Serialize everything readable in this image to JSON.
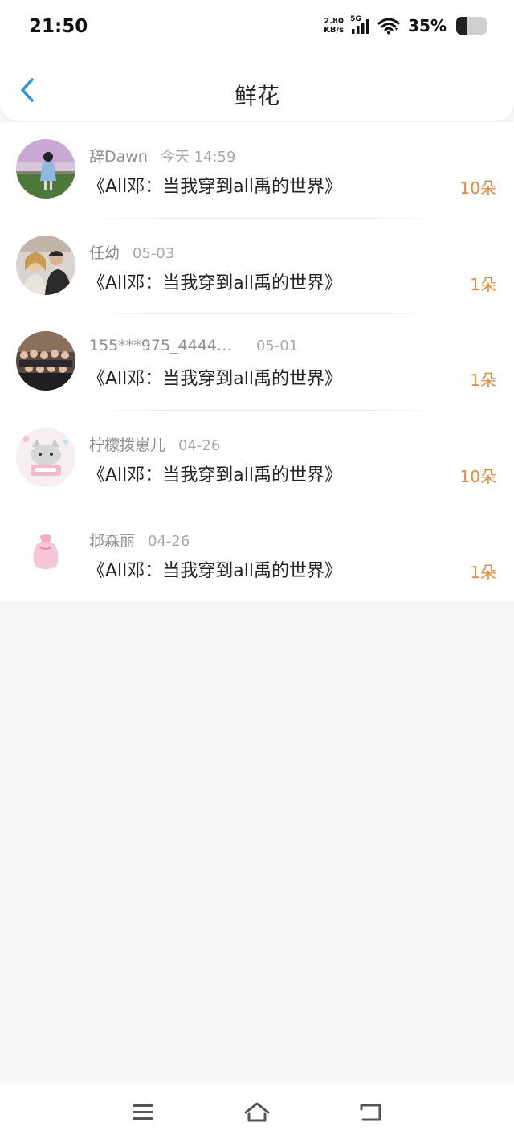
{
  "status_bar": {
    "time": "21:50",
    "net_speed_value": "2.80",
    "net_speed_unit": "KB/s",
    "network_type": "5G",
    "battery_percent": "35%",
    "battery_level": 0.35
  },
  "header": {
    "title": "鲜花",
    "back_icon": "chevron-left-icon",
    "accent_color": "#2b8fe6"
  },
  "flowers": [
    {
      "user": "辞Dawn",
      "date": "今天 14:59",
      "book": "《All邓：当我穿到all禹的世界》",
      "count": "10朵"
    },
    {
      "user": "任幼",
      "date": "05-03",
      "book": "《All邓：当我穿到all禹的世界》",
      "count": "1朵"
    },
    {
      "user": "155***975_4444…",
      "date": "05-01",
      "book": "《All邓：当我穿到all禹的世界》",
      "count": "1朵"
    },
    {
      "user": "柠檬拨崽儿",
      "date": "04-26",
      "book": "《All邓：当我穿到all禹的世界》",
      "count": "10朵"
    },
    {
      "user": "邶森丽",
      "date": "04-26",
      "book": "《All邓：当我穿到all禹的世界》",
      "count": "1朵"
    }
  ],
  "count_color": "#e8873a",
  "nav_bar": {
    "icons": [
      "menu-icon",
      "home-icon",
      "back-icon"
    ]
  }
}
